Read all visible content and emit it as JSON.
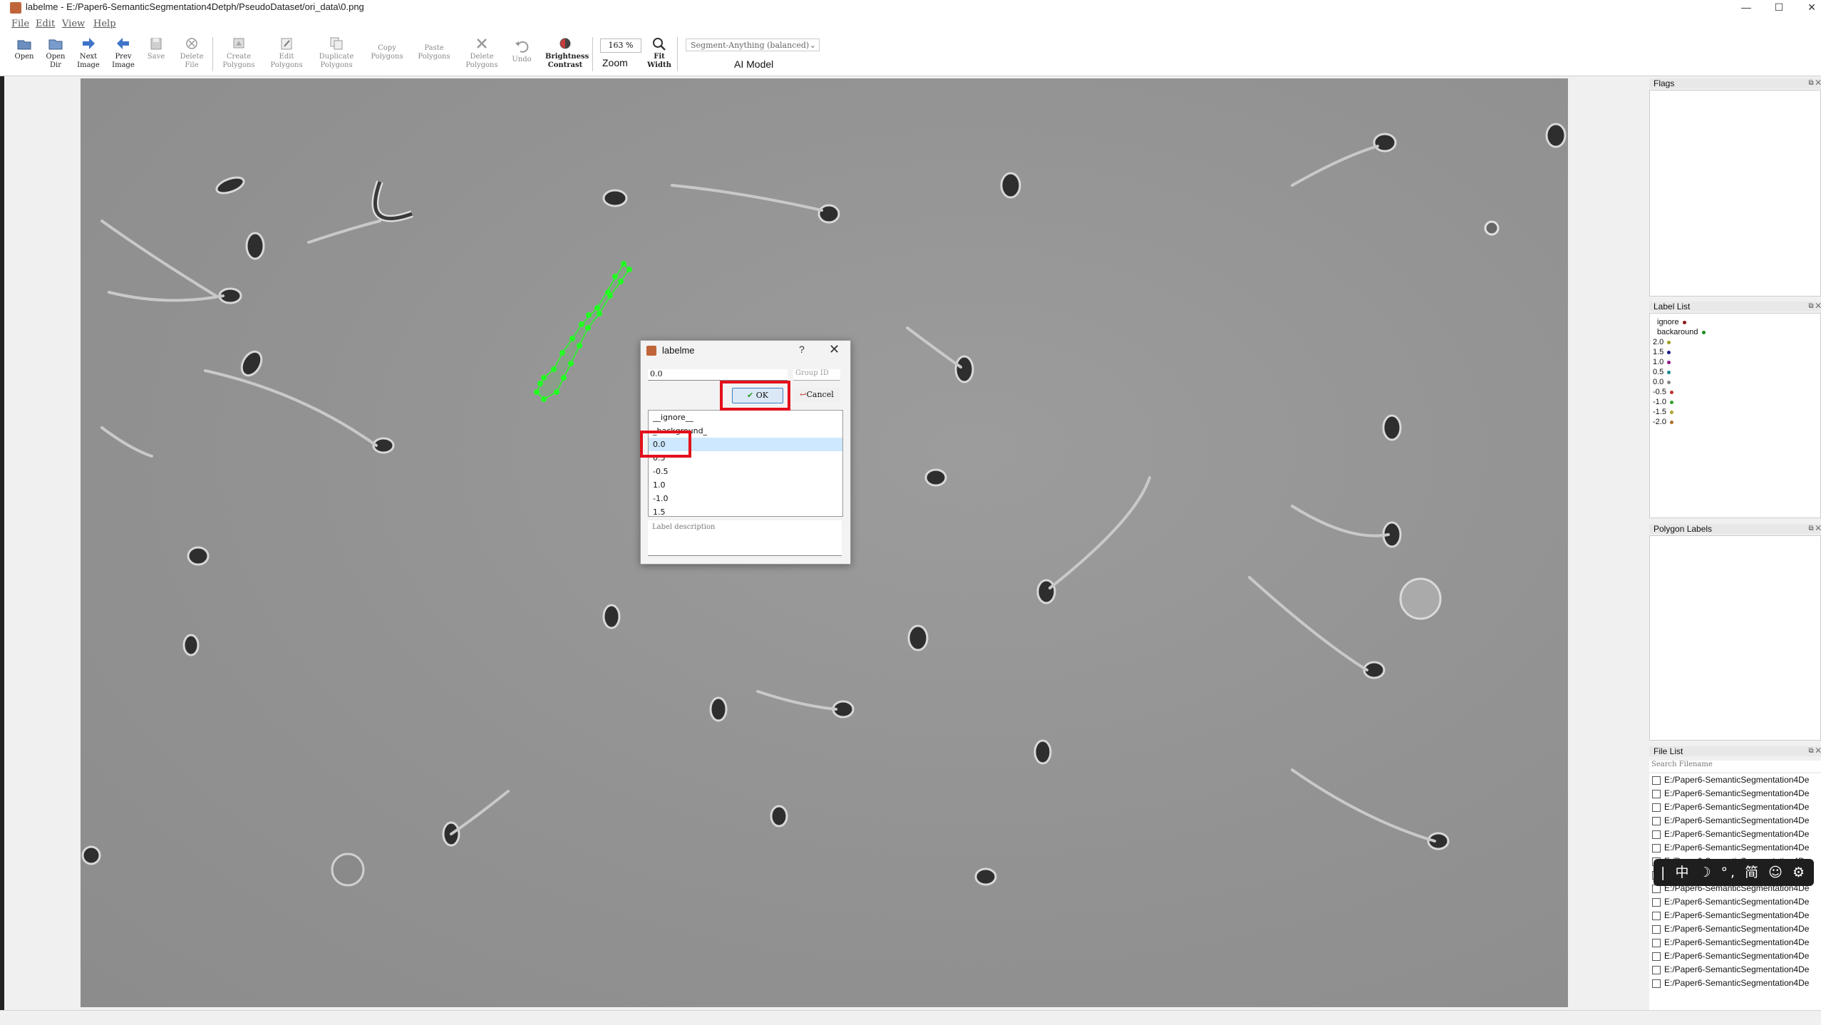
{
  "window": {
    "title": "labelme - E:/Paper6-SemanticSegmentation4Detph/PseudoDataset/ori_data\\0.png",
    "minimize": "—",
    "maximize": "☐",
    "close": "✕"
  },
  "menu": [
    "File",
    "Edit",
    "View",
    "Help"
  ],
  "toolbar": {
    "open": "Open",
    "open_dir": "Open\nDir",
    "next_image": "Next\nImage",
    "prev_image": "Prev\nImage",
    "save": "Save",
    "delete_file": "Delete\nFile",
    "create_polygons": "Create\nPolygons",
    "edit_polygons": "Edit\nPolygons",
    "duplicate_polygons": "Duplicate\nPolygons",
    "copy_polygons": "Copy\nPolygons",
    "paste_polygons": "Paste\nPolygons",
    "delete_polygons": "Delete\nPolygons",
    "undo": "Undo",
    "brightness_contrast": "Brightness\nContrast",
    "zoom_value": "163 %",
    "zoom_label": "Zoom",
    "fit_width": "Fit\nWidth",
    "ai_model_value": "Segment-Anything (balanced)",
    "ai_model_label": "AI Model"
  },
  "dialog": {
    "title": "labelme",
    "help": "?",
    "close": "✕",
    "label_value": "0.0",
    "group_id_placeholder": "Group ID",
    "ok": "OK",
    "cancel": "Cancel",
    "labels": [
      "__ignore__",
      "_background_",
      "0.0",
      "0.5",
      "-0.5",
      "1.0",
      "-1.0",
      "1.5"
    ],
    "selected_index": 2,
    "description_placeholder": "Label description"
  },
  "docks": {
    "flags_title": "Flags",
    "label_list_title": "Label List",
    "polygon_labels_title": "Polygon Labels",
    "file_list_title": "File List",
    "dock_controls": "⧉ ✕"
  },
  "label_list": [
    {
      "text": "ignore",
      "color": "#8b1a1a"
    },
    {
      "text": "backaround",
      "color": "#1a8b1a"
    },
    {
      "text": "2.0",
      "color": "#a0a020"
    },
    {
      "text": "1.5",
      "color": "#1a1a8b"
    },
    {
      "text": "1.0",
      "color": "#8b1a8b"
    },
    {
      "text": "0.5",
      "color": "#1a8b8b"
    },
    {
      "text": "0.0",
      "color": "#888888"
    },
    {
      "text": "-0.5",
      "color": "#c03030"
    },
    {
      "text": "-1.0",
      "color": "#30a030"
    },
    {
      "text": "-1.5",
      "color": "#b0a030"
    },
    {
      "text": "-2.0",
      "color": "#b07030"
    }
  ],
  "file_list": {
    "search_placeholder": "Search Filename",
    "files": [
      "E:/Paper6-SemanticSegmentation4De",
      "E:/Paper6-SemanticSegmentation4De",
      "E:/Paper6-SemanticSegmentation4De",
      "E:/Paper6-SemanticSegmentation4De",
      "E:/Paper6-SemanticSegmentation4De",
      "E:/Paper6-SemanticSegmentation4De",
      "E:/Paper6-SemanticSegmentation4De",
      "E:/Paper6-SemanticSegmentation4De",
      "E:/Paper6-SemanticSegmentation4De",
      "E:/Paper6-SemanticSegmentation4De",
      "E:/Paper6-SemanticSegmentation4De",
      "E:/Paper6-SemanticSegmentation4De",
      "E:/Paper6-SemanticSegmentation4De",
      "E:/Paper6-SemanticSegmentation4De",
      "E:/Paper6-SemanticSegmentation4De",
      "E:/Paper6-SemanticSegmentation4De"
    ]
  },
  "ime_bar": "| 中 ☽ °, 简 ☺ ⚙",
  "colors": {
    "annotation_green": "#22ff22",
    "highlight_red": "#e3101b",
    "selection_blue": "#cde8ff"
  }
}
